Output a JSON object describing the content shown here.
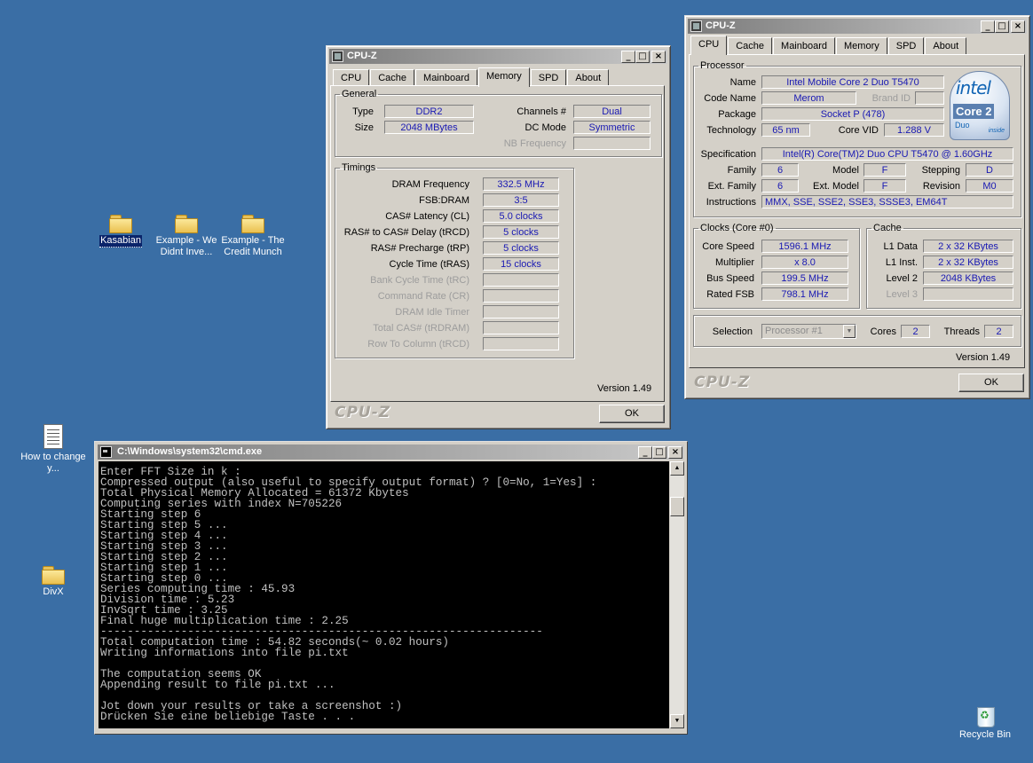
{
  "desktop": {
    "icons": [
      {
        "label": "Kasabian"
      },
      {
        "label": "Example - We Didnt Inve..."
      },
      {
        "label": "Example - The Credit Munch"
      },
      {
        "label": "How to change y..."
      },
      {
        "label": "DivX"
      },
      {
        "label": "Recycle Bin"
      }
    ]
  },
  "cpuz_memory": {
    "title": "CPU-Z",
    "tabs": [
      "CPU",
      "Cache",
      "Mainboard",
      "Memory",
      "SPD",
      "About"
    ],
    "active_tab": "Memory",
    "general": {
      "legend": "General",
      "type_label": "Type",
      "type_value": "DDR2",
      "size_label": "Size",
      "size_value": "2048 MBytes",
      "channels_label": "Channels #",
      "channels_value": "Dual",
      "dcmode_label": "DC Mode",
      "dcmode_value": "Symmetric",
      "nbfreq_label": "NB Frequency",
      "nbfreq_value": ""
    },
    "timings": {
      "legend": "Timings",
      "rows": [
        {
          "label": "DRAM Frequency",
          "value": "332.5 MHz",
          "enabled": true
        },
        {
          "label": "FSB:DRAM",
          "value": "3:5",
          "enabled": true
        },
        {
          "label": "CAS# Latency (CL)",
          "value": "5.0 clocks",
          "enabled": true
        },
        {
          "label": "RAS# to CAS# Delay (tRCD)",
          "value": "5 clocks",
          "enabled": true
        },
        {
          "label": "RAS# Precharge (tRP)",
          "value": "5 clocks",
          "enabled": true
        },
        {
          "label": "Cycle Time (tRAS)",
          "value": "15 clocks",
          "enabled": true
        },
        {
          "label": "Bank Cycle Time (tRC)",
          "value": "",
          "enabled": false
        },
        {
          "label": "Command Rate (CR)",
          "value": "",
          "enabled": false
        },
        {
          "label": "DRAM Idle Timer",
          "value": "",
          "enabled": false
        },
        {
          "label": "Total CAS# (tRDRAM)",
          "value": "",
          "enabled": false
        },
        {
          "label": "Row To Column (tRCD)",
          "value": "",
          "enabled": false
        }
      ]
    },
    "version": "Version 1.49",
    "brand": "CPU-Z",
    "ok_label": "OK"
  },
  "cpuz_cpu": {
    "title": "CPU-Z",
    "tabs": [
      "CPU",
      "Cache",
      "Mainboard",
      "Memory",
      "SPD",
      "About"
    ],
    "active_tab": "CPU",
    "processor": {
      "legend": "Processor",
      "name_label": "Name",
      "name_value": "Intel Mobile Core 2 Duo T5470",
      "codename_label": "Code Name",
      "codename_value": "Merom",
      "brandid_label": "Brand ID",
      "brandid_value": "",
      "package_label": "Package",
      "package_value": "Socket P (478)",
      "technology_label": "Technology",
      "technology_value": "65 nm",
      "corevid_label": "Core VID",
      "corevid_value": "1.288 V",
      "spec_label": "Specification",
      "spec_value": "Intel(R) Core(TM)2 Duo CPU     T5470  @ 1.60GHz",
      "family_label": "Family",
      "family_value": "6",
      "model_label": "Model",
      "model_value": "F",
      "stepping_label": "Stepping",
      "stepping_value": "D",
      "extfamily_label": "Ext. Family",
      "extfamily_value": "6",
      "extmodel_label": "Ext. Model",
      "extmodel_value": "F",
      "revision_label": "Revision",
      "revision_value": "M0",
      "instructions_label": "Instructions",
      "instructions_value": "MMX, SSE, SSE2, SSE3, SSSE3, EM64T"
    },
    "logo": {
      "word": "intel",
      "line2": "Core 2",
      "line3": "Duo",
      "tag": "inside",
      "icon": "intel-core2-duo-logo"
    },
    "clocks": {
      "legend": "Clocks (Core #0)",
      "corespeed_label": "Core Speed",
      "corespeed_value": "1596.1 MHz",
      "multiplier_label": "Multiplier",
      "multiplier_value": "x 8.0",
      "busspeed_label": "Bus Speed",
      "busspeed_value": "199.5 MHz",
      "ratedfsb_label": "Rated FSB",
      "ratedfsb_value": "798.1 MHz"
    },
    "cache": {
      "legend": "Cache",
      "l1data_label": "L1 Data",
      "l1data_value": "2 x 32 KBytes",
      "l1inst_label": "L1 Inst.",
      "l1inst_value": "2 x 32 KBytes",
      "level2_label": "Level 2",
      "level2_value": "2048 KBytes",
      "level3_label": "Level 3",
      "level3_value": ""
    },
    "selection_label": "Selection",
    "selection_value": "Processor #1",
    "cores_label": "Cores",
    "cores_value": "2",
    "threads_label": "Threads",
    "threads_value": "2",
    "version": "Version 1.49",
    "brand": "CPU-Z",
    "ok_label": "OK"
  },
  "cmd": {
    "title": "C:\\Windows\\system32\\cmd.exe",
    "lines": [
      "Enter FFT Size in k :",
      "Compressed output (also useful to specify output format) ? [0=No, 1=Yes] :",
      "Total Physical Memory Allocated = 61372 Kbytes",
      "Computing series with index N=705226",
      "Starting step 6",
      "Starting step 5 ...",
      "Starting step 4 ...",
      "Starting step 3 ...",
      "Starting step 2 ...",
      "Starting step 1 ...",
      "Starting step 0 ...",
      "Series computing time : 45.93",
      "Division time : 5.23",
      "InvSqrt time : 3.25",
      "Final huge multiplication time : 2.25",
      "------------------------------------------------------------------",
      "Total computation time : 54.82 seconds(~ 0.02 hours)",
      "Writing informations into file pi.txt",
      "",
      "The computation seems OK",
      "Appending result to file pi.txt ...",
      "",
      "Jot down your results or take a screenshot :)",
      "Drücken Sie eine beliebige Taste . . ."
    ]
  }
}
